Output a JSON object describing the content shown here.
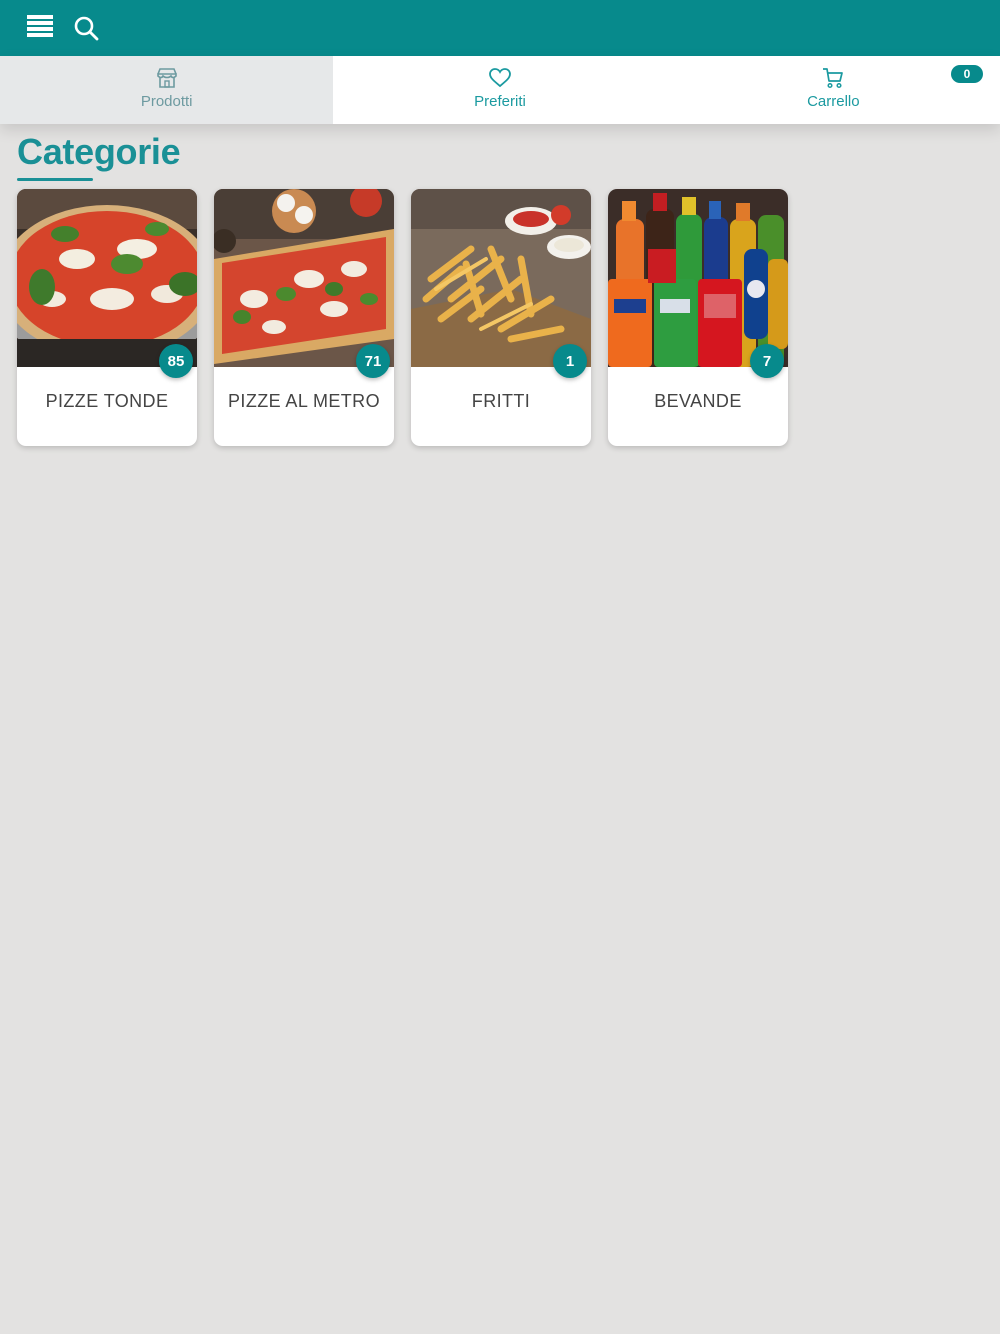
{
  "header": {
    "menu_icon": "menu-icon",
    "search_icon": "search-icon",
    "color": "#078a8c"
  },
  "tabs": [
    {
      "label": "Prodotti",
      "icon": "store-icon",
      "active": true
    },
    {
      "label": "Preferiti",
      "icon": "heart-icon",
      "active": false
    },
    {
      "label": "Carrello",
      "icon": "cart-icon",
      "active": false,
      "badge": "0"
    }
  ],
  "main": {
    "title": "Categorie",
    "categories": [
      {
        "name": "PIZZE TONDE",
        "count": "85",
        "image": "round-pizza-image"
      },
      {
        "name": "PIZZE AL METRO",
        "count": "71",
        "image": "pizza-by-the-meter-image"
      },
      {
        "name": "FRITTI",
        "count": "1",
        "image": "french-fries-image"
      },
      {
        "name": "BEVANDE",
        "count": "7",
        "image": "soft-drinks-image"
      }
    ]
  },
  "colors": {
    "accent": "#078a8c",
    "title": "#1a9096",
    "background": "#e3e2e1"
  }
}
